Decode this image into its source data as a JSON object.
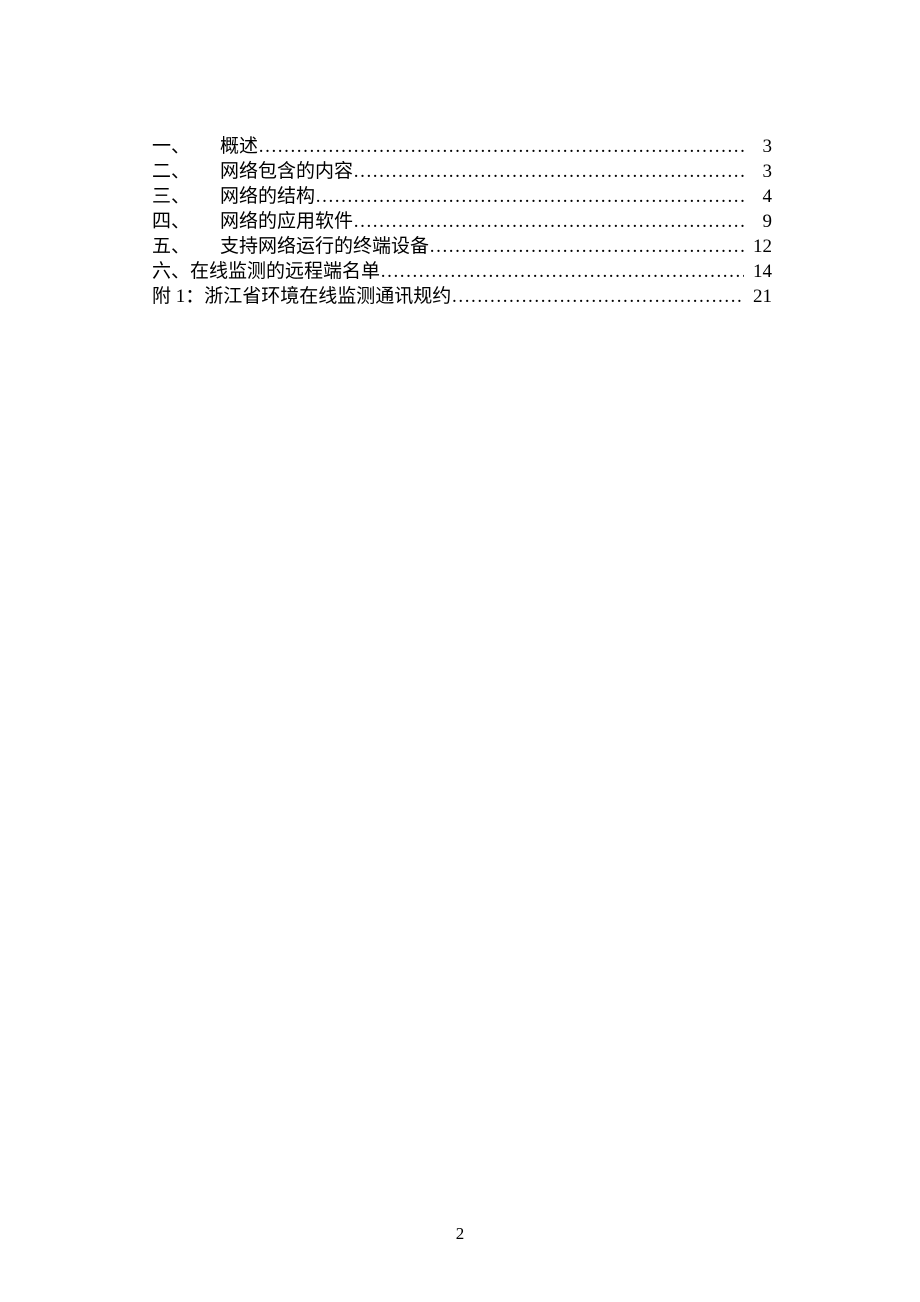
{
  "toc": [
    {
      "num": "一、",
      "title": "概述",
      "page": "3",
      "indent": true
    },
    {
      "num": "二、",
      "title": "网络包含的内容",
      "page": "3",
      "indent": true
    },
    {
      "num": "三、",
      "title": "网络的结构",
      "page": "4",
      "indent": true
    },
    {
      "num": "四、",
      "title": "网络的应用软件",
      "page": "9",
      "indent": true
    },
    {
      "num": "五、",
      "title": "支持网络运行的终端设备",
      "page": "12",
      "indent": true
    },
    {
      "num": "六、",
      "title": "在线监测的远程端名单",
      "page": "14",
      "indent": false
    },
    {
      "num": "附 1：",
      "title": "浙江省环境在线监测通讯规约",
      "page": "21",
      "indent": false
    }
  ],
  "pageNumber": "2"
}
